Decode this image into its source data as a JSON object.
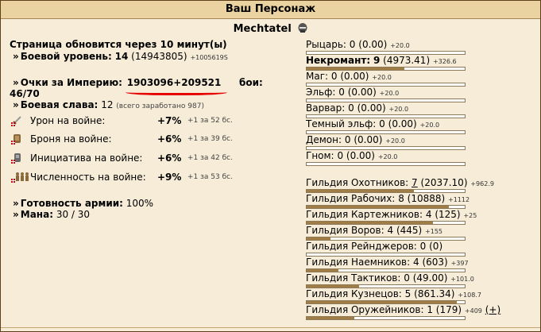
{
  "header": {
    "title": "Ваш Персонаж"
  },
  "character": {
    "name": "Mechtatel"
  },
  "left": {
    "refresh_text": "Страница обновится через 10 минут(ы)",
    "combat_level_label": "Боевой уровень:",
    "combat_level_value": "14",
    "combat_level_exp": "(14943805)",
    "combat_level_next": "+1005619S",
    "empire_label": "Очки за Империю:",
    "empire_value": "1903096+209521",
    "fights_label": "бои:",
    "fights_value": "46/70",
    "glory_label": "Боевая слава:",
    "glory_value": "12",
    "glory_note": "(всего заработано 987)",
    "war_bonuses": [
      {
        "label": "Урон на войне:",
        "value": "+7%",
        "note": "+1 за 52 бс."
      },
      {
        "label": "Броня на войне:",
        "value": "+6%",
        "note": "+1 за 39 бс."
      },
      {
        "label": "Инициатива на войне:",
        "value": "+6%",
        "note": "+1 за 42 бс."
      },
      {
        "label": "Численность на войне:",
        "value": "+9%",
        "note": "+1 за 53 бс."
      }
    ],
    "army_ready_label": "Готовность армии:",
    "army_ready_value": "100%",
    "mana_label": "Мана:",
    "mana_value": "30 / 30"
  },
  "factions": [
    {
      "name": "Рыцарь:",
      "level": "0",
      "points": "(0.00)",
      "next": "+20.0",
      "progress": 0,
      "bold": false
    },
    {
      "name": "Некромант:",
      "level": "9",
      "points": "(4973.41)",
      "next": "+326.6",
      "progress": 0.62,
      "bold": true
    },
    {
      "name": "Маг:",
      "level": "0",
      "points": "(0.00)",
      "next": "+20.0",
      "progress": 0,
      "bold": false
    },
    {
      "name": "Эльф:",
      "level": "0",
      "points": "(0.00)",
      "next": "+20.0",
      "progress": 0,
      "bold": false
    },
    {
      "name": "Варвар:",
      "level": "0",
      "points": "(0.00)",
      "next": "+20.0",
      "progress": 0,
      "bold": false
    },
    {
      "name": "Темный эльф:",
      "level": "0",
      "points": "(0.00)",
      "next": "+20.0",
      "progress": 0,
      "bold": false
    },
    {
      "name": "Демон:",
      "level": "0",
      "points": "(0.00)",
      "next": "+20.0",
      "progress": 0,
      "bold": false
    },
    {
      "name": "Гном:",
      "level": "0",
      "points": "(0.00)",
      "next": "+20.0",
      "progress": 0,
      "bold": false
    }
  ],
  "guilds": [
    {
      "name": "Гильдия Охотников:",
      "level": "7",
      "points": "(2037.10)",
      "next": "+962.9",
      "progress": 0.68,
      "link": true
    },
    {
      "name": "Гильдия Рабочих:",
      "level": "8",
      "points": "(10888)",
      "next": "+1112",
      "progress": 0.9,
      "link": false
    },
    {
      "name": "Гильдия Картежников:",
      "level": "4",
      "points": "(125)",
      "next": "+25",
      "progress": 0.8,
      "link": false
    },
    {
      "name": "Гильдия Воров:",
      "level": "4",
      "points": "(445)",
      "next": "+155",
      "progress": 0.15,
      "link": false
    },
    {
      "name": "Гильдия Рейнджеров:",
      "level": "0",
      "points": "(0)",
      "next": "",
      "progress": 0,
      "link": false
    },
    {
      "name": "Гильдия Наемников:",
      "level": "4",
      "points": "(603)",
      "next": "+397",
      "progress": 0.2,
      "link": false
    },
    {
      "name": "Гильдия Тактиков:",
      "level": "0",
      "points": "(49.00)",
      "next": "+101.0",
      "progress": 0.33,
      "link": false
    },
    {
      "name": "Гильдия Кузнецов:",
      "level": "5",
      "points": "(861.34)",
      "next": "+108.7",
      "progress": 0.95,
      "link": false
    },
    {
      "name": "Гильдия Оружейников:",
      "level": "1",
      "points": "(179)",
      "next": "+409",
      "progress": 0.3,
      "link": false,
      "plus": "(+)"
    }
  ]
}
